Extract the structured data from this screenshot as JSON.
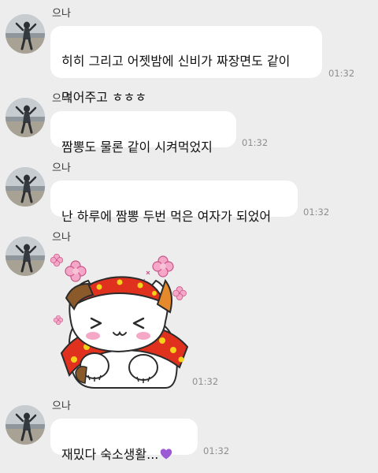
{
  "messages": [
    {
      "sender": "으나",
      "lines": [
        "히히 그리고 어젯밤에 신비가 짜장면도 같이",
        "먹어주고 ㅎㅎㅎ"
      ],
      "time": "01:32"
    },
    {
      "sender": "으나",
      "lines": [
        "짬뽕도 물론 같이 시켜먹었지"
      ],
      "time": "01:32"
    },
    {
      "sender": "으나",
      "lines": [
        "난 하루에 짬뽕 두번 먹은 여자가 되었어"
      ],
      "time": "01:32"
    },
    {
      "sender": "으나",
      "sticker": "calico-cat-with-red-polka-dot-scarf-blushing",
      "time": "01:32"
    },
    {
      "sender": "으나",
      "lines": [
        "재밌다 숙소생활..."
      ],
      "emoji": "purple-heart",
      "time": "01:32"
    }
  ],
  "colors": {
    "background": "#ededed",
    "bubble": "#ffffff",
    "text": "#111111",
    "time": "#8e8e8e",
    "heart": "#9b59d6"
  }
}
